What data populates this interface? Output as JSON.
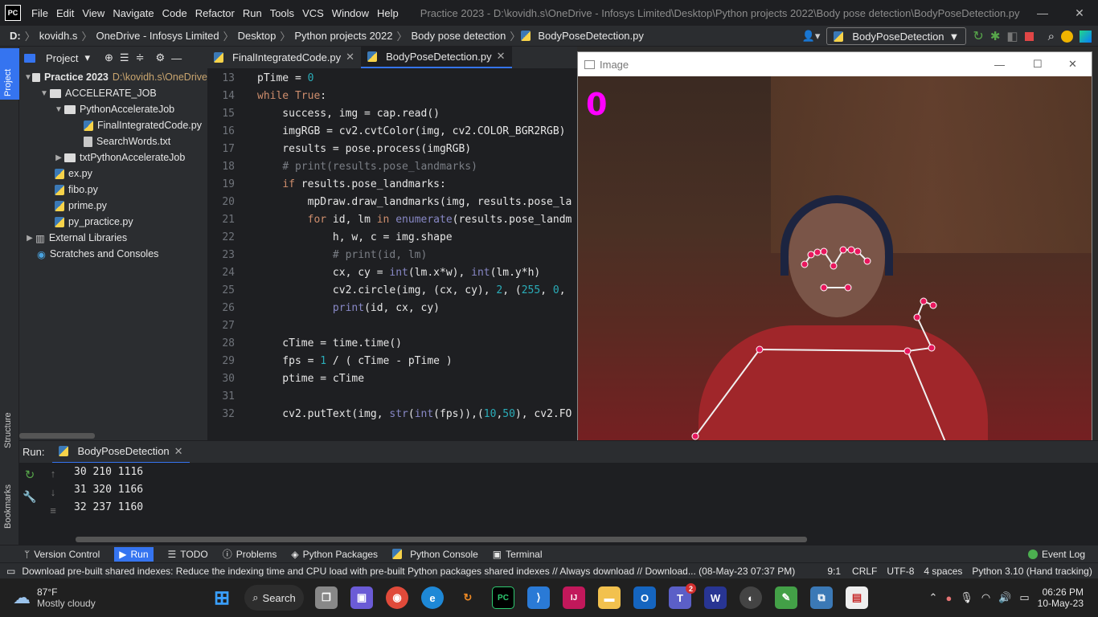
{
  "titlebar": {
    "logo": "PC",
    "menu": [
      "File",
      "Edit",
      "View",
      "Navigate",
      "Code",
      "Refactor",
      "Run",
      "Tools",
      "VCS",
      "Window",
      "Help"
    ],
    "window_title": "Practice 2023 - D:\\kovidh.s\\OneDrive - Infosys Limited\\Desktop\\Python projects 2022\\Body pose detection\\BodyPoseDetection.py"
  },
  "navbar": {
    "breadcrumbs": [
      "D:",
      "kovidh.s",
      "OneDrive - Infosys Limited",
      "Desktop",
      "Python projects 2022",
      "Body pose detection",
      "BodyPoseDetection.py"
    ],
    "run_config": "BodyPoseDetection"
  },
  "left_strip": {
    "project_tab": "Project",
    "structure_tab": "Structure",
    "bookmarks_tab": "Bookmarks"
  },
  "project": {
    "header": "Project",
    "tree": [
      {
        "label": "Practice 2023",
        "path": "D:\\kovidh.s\\OneDrive",
        "type": "folder"
      },
      {
        "label": "ACCELERATE_JOB",
        "type": "folder"
      },
      {
        "label": "PythonAccelerateJob",
        "type": "folder"
      },
      {
        "label": "FinalIntegratedCode.py",
        "type": "py"
      },
      {
        "label": "SearchWords.txt",
        "type": "txt"
      },
      {
        "label": "txtPythonAccelerateJob",
        "type": "folder"
      },
      {
        "label": "ex.py",
        "type": "py"
      },
      {
        "label": "fibo.py",
        "type": "py"
      },
      {
        "label": "prime.py",
        "type": "py"
      },
      {
        "label": "py_practice.py",
        "type": "py"
      },
      {
        "label": "External Libraries",
        "type": "lib"
      },
      {
        "label": "Scratches and Consoles",
        "type": "scratch"
      }
    ]
  },
  "editor": {
    "tabs": [
      {
        "label": "FinalIntegratedCode.py"
      },
      {
        "label": "BodyPoseDetection.py"
      }
    ],
    "lines": [
      {
        "n": "13",
        "html": "pTime = <span class='num'>0</span>"
      },
      {
        "n": "14",
        "html": "<span class='kw'>while</span> <span class='kw'>True</span>:"
      },
      {
        "n": "15",
        "html": "    success, img = cap.read()"
      },
      {
        "n": "16",
        "html": "    imgRGB = cv2.cvtColor(img, cv2.COLOR_BGR2RGB)"
      },
      {
        "n": "17",
        "html": "    results = pose.process(imgRGB)"
      },
      {
        "n": "18",
        "html": "    <span class='cm'># print(results.pose_landmarks)</span>"
      },
      {
        "n": "19",
        "html": "    <span class='kw'>if</span> results.pose_landmarks:"
      },
      {
        "n": "20",
        "html": "        mpDraw.draw_landmarks(img, results.pose_la"
      },
      {
        "n": "21",
        "html": "        <span class='kw'>for</span> id, lm <span class='kw'>in</span> <span class='bi'>enumerate</span>(results.pose_landm"
      },
      {
        "n": "22",
        "html": "            h, w, c = img.shape"
      },
      {
        "n": "23",
        "html": "            <span class='cm'># print(id, lm)</span>"
      },
      {
        "n": "24",
        "html": "            cx, cy = <span class='bi'>int</span>(lm.x*w), <span class='bi'>int</span>(lm.y*h)"
      },
      {
        "n": "25",
        "html": "            cv2.circle(img, (cx, cy), <span class='num'>2</span>, (<span class='num'>255</span>, <span class='num'>0</span>,"
      },
      {
        "n": "26",
        "html": "            <span class='bi'>print</span>(id, cx, cy)"
      },
      {
        "n": "27",
        "html": ""
      },
      {
        "n": "28",
        "html": "    cTime = time.time()"
      },
      {
        "n": "29",
        "html": "    fps = <span class='num'>1</span> / ( cTime - pTime )"
      },
      {
        "n": "30",
        "html": "    ptime = cTime"
      },
      {
        "n": "31",
        "html": ""
      },
      {
        "n": "32",
        "html": "    cv2.putText(img, <span class='bi'>str</span>(<span class='bi'>int</span>(fps)),(<span class='num'>10</span>,<span class='num'>50</span>), cv2.FO"
      }
    ]
  },
  "image_window": {
    "title": "Image",
    "fps_text": "0"
  },
  "run_panel": {
    "label": "Run:",
    "tab": "BodyPoseDetection",
    "output": [
      "30 210 1116",
      "31 320 1166",
      "32 237 1160"
    ]
  },
  "bottom_tabs": [
    "Version Control",
    "Run",
    "TODO",
    "Problems",
    "Python Packages",
    "Python Console",
    "Terminal"
  ],
  "event_log": "Event Log",
  "status": {
    "message": "Download pre-built shared indexes: Reduce the indexing time and CPU load with pre-built Python packages shared indexes // Always download // Download... (08-May-23 07:37 PM)",
    "position": "9:1",
    "line_sep": "CRLF",
    "encoding": "UTF-8",
    "indent": "4 spaces",
    "interpreter": "Python 3.10 (Hand tracking)"
  },
  "taskbar": {
    "temp": "87°F",
    "weather": "Mostly cloudy",
    "search": "Search",
    "time": "06:26 PM",
    "date": "10-May-23",
    "teams_badge": "2"
  }
}
